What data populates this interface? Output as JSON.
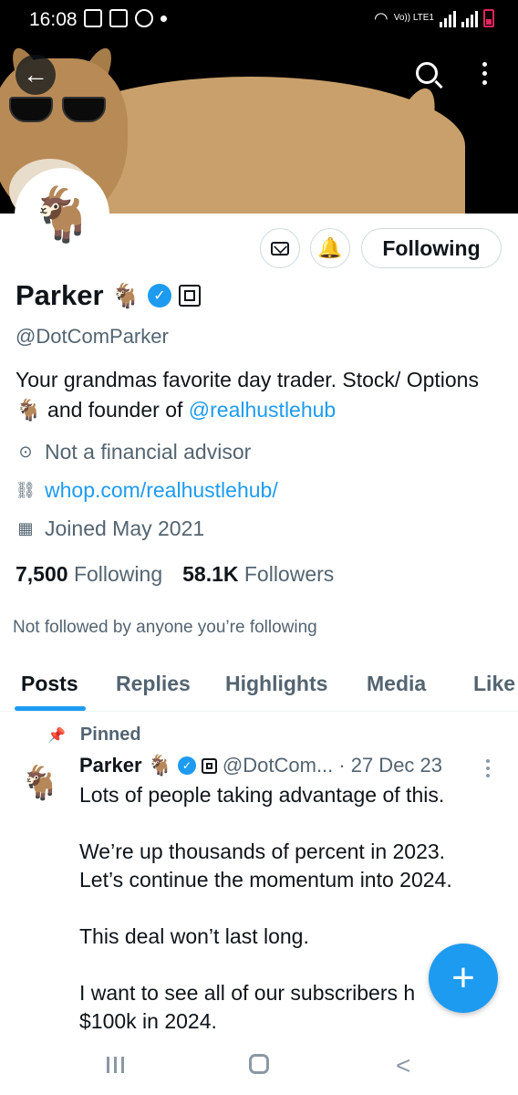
{
  "status_bar": {
    "time": "16:08",
    "network_label": "Vo)) LTE1",
    "icons": [
      "gallery-icon",
      "calendar-icon",
      "sync-icon",
      "dot-icon",
      "wifi-icon",
      "signal-icon",
      "battery-icon"
    ]
  },
  "profile": {
    "name": "Parker",
    "name_emoji": "🐐",
    "handle": "@DotComParker",
    "bio_text": "Your grandmas favorite day trader. Stock/ Options 🐐 and founder of ",
    "bio_link": "@realhustlehub",
    "location": "Not a financial advisor",
    "website": "whop.com/realhustlehub/",
    "joined": "Joined May 2021",
    "following_count": "7,500",
    "following_label": "Following",
    "followers_count": "58.1K",
    "followers_label": "Followers",
    "not_followed": "Not followed by anyone you’re following",
    "avatar_emoji": "🐐"
  },
  "actions": {
    "following_button": "Following"
  },
  "tabs": [
    "Posts",
    "Replies",
    "Highlights",
    "Media",
    "Like"
  ],
  "post": {
    "pinned_label": "Pinned",
    "author": "Parker",
    "author_emoji": "🐐",
    "handle": "@DotCom...",
    "date": "· 27 Dec 23",
    "avatar_emoji": "🐐",
    "body": "Lots of people taking advantage of this.\n\nWe’re up thousands of percent in 2023.\nLet’s continue the momentum into 2024.\n\nThis deal won’t last long.\n\nI want to see all of our subscribers h\n$100k in 2024."
  },
  "fab": {
    "label": "+"
  },
  "colors": {
    "accent": "#1d9bf0",
    "text": "#0f1419",
    "muted": "#536471"
  }
}
